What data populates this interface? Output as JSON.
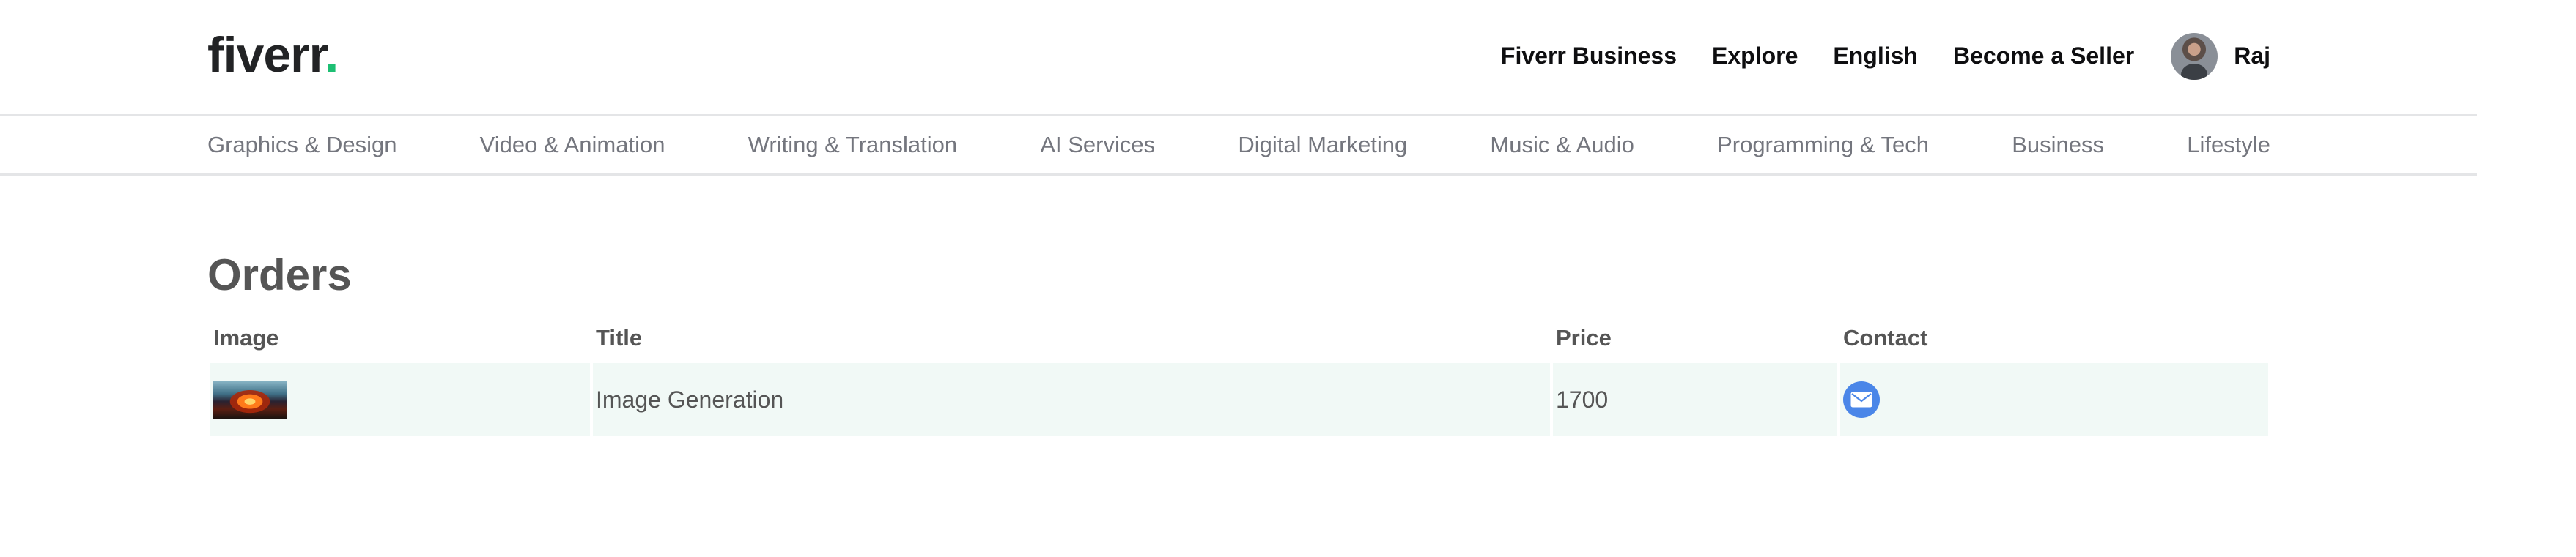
{
  "navbar": {
    "logo_text": "fiverr",
    "logo_dot": ".",
    "links": {
      "business": "Fiverr Business",
      "explore": "Explore",
      "language": "English",
      "become_seller": "Become a Seller"
    },
    "user": {
      "name": "Raj"
    }
  },
  "categories": [
    "Graphics & Design",
    "Video & Animation",
    "Writing & Translation",
    "AI Services",
    "Digital Marketing",
    "Music & Audio",
    "Programming & Tech",
    "Business",
    "Lifestyle"
  ],
  "orders": {
    "title": "Orders",
    "columns": {
      "image": "Image",
      "title": "Title",
      "price": "Price",
      "contact": "Contact"
    },
    "rows": [
      {
        "title": "Image Generation",
        "price": "1700",
        "contact_icon": "mail-icon"
      }
    ]
  },
  "colors": {
    "brand_green": "#1dbf73",
    "row_background": "#f1f9f6",
    "contact_button": "#4a86e8"
  }
}
